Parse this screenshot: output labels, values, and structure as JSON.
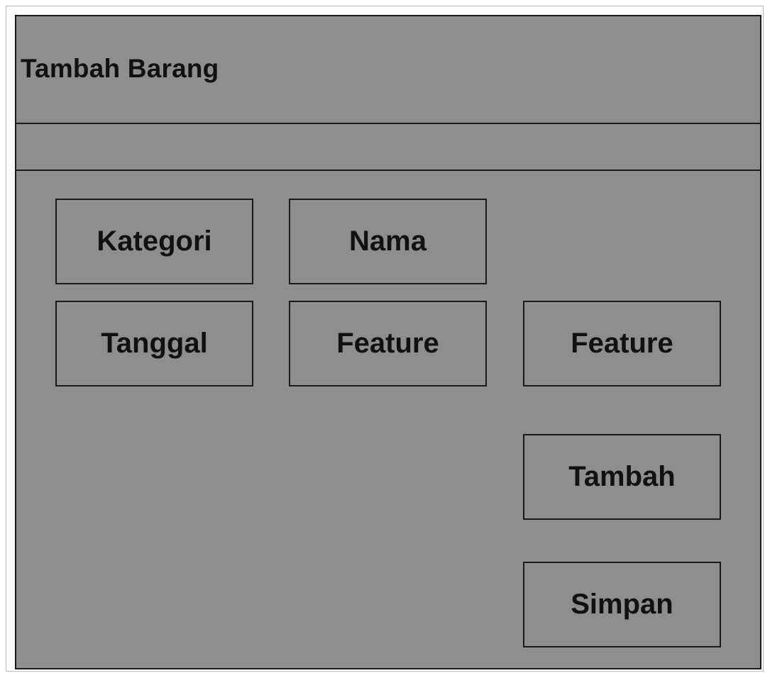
{
  "header": {
    "title": "Tambah Barang"
  },
  "form": {
    "fields": {
      "kategori": "Kategori",
      "nama": "Nama",
      "tanggal": "Tanggal",
      "feature_1": "Feature",
      "feature_2": "Feature"
    },
    "actions": {
      "tambah": "Tambah",
      "simpan": "Simpan"
    }
  },
  "colors": {
    "panel_background": "#8e8e8e",
    "border": "#1a1a1a",
    "text": "#111111"
  }
}
